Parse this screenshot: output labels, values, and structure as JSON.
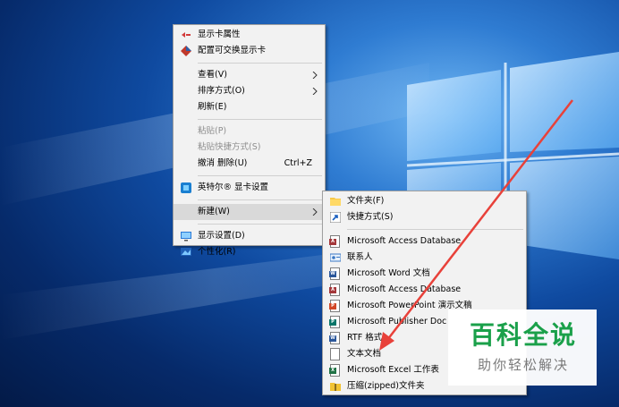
{
  "colors": {
    "menu_bg": "#f2f2f2",
    "menu_hover": "#d9d9d9",
    "disabled_text": "#8e8e8e",
    "arrow": "#e8413a",
    "watermark_green": "#1aa04a"
  },
  "context_menu": {
    "items": [
      {
        "label": "显示卡属性",
        "icon": "graphics-properties-icon"
      },
      {
        "label": "配置可交换显示卡",
        "icon": "switchable-graphics-icon"
      },
      {
        "label": "查看(V)",
        "submenu": true
      },
      {
        "label": "排序方式(O)",
        "submenu": true
      },
      {
        "label": "刷新(E)"
      },
      {
        "label": "粘贴(P)",
        "disabled": true
      },
      {
        "label": "粘贴快捷方式(S)",
        "disabled": true
      },
      {
        "label": "撤消 删除(U)",
        "shortcut": "Ctrl+Z"
      },
      {
        "label": "英特尔® 显卡设置",
        "icon": "intel-graphics-icon"
      },
      {
        "label": "新建(W)",
        "submenu": true,
        "highlighted": true
      },
      {
        "label": "显示设置(D)",
        "icon": "display-settings-icon"
      },
      {
        "label": "个性化(R)",
        "icon": "personalize-icon"
      }
    ]
  },
  "new_submenu": {
    "items": [
      {
        "label": "文件夹(F)",
        "icon": "folder-icon"
      },
      {
        "label": "快捷方式(S)",
        "icon": "shortcut-icon"
      },
      {
        "label": "Microsoft Access Database",
        "icon": "access-icon"
      },
      {
        "label": "联系人",
        "icon": "contact-icon"
      },
      {
        "label": "Microsoft Word 文档",
        "icon": "word-icon"
      },
      {
        "label": "Microsoft Access Database",
        "icon": "access-icon"
      },
      {
        "label": "Microsoft PowerPoint 演示文稿",
        "icon": "powerpoint-icon"
      },
      {
        "label": "Microsoft Publisher Doc",
        "icon": "publisher-icon"
      },
      {
        "label": "RTF 格式",
        "icon": "rtf-icon"
      },
      {
        "label": "文本文档",
        "icon": "text-document-icon"
      },
      {
        "label": "Microsoft Excel 工作表",
        "icon": "excel-icon"
      },
      {
        "label": "压缩(zipped)文件夹",
        "icon": "zip-folder-icon"
      }
    ]
  },
  "watermark": {
    "title": "百科全说",
    "subtitle": "助你轻松解决"
  }
}
